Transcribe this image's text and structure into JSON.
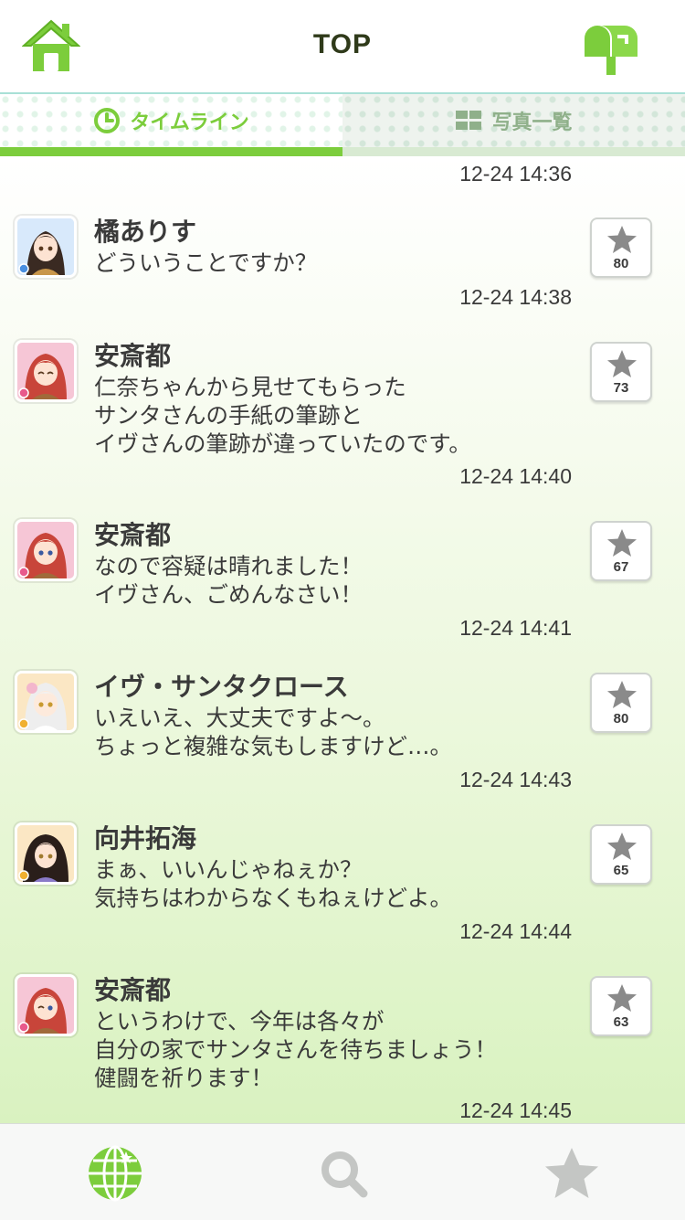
{
  "header": {
    "title": "TOP",
    "home_icon": "home-icon",
    "mail_icon": "mailbox-icon"
  },
  "tabs": [
    {
      "label": "タイムライン",
      "icon": "clock-icon",
      "active": true
    },
    {
      "label": "写真一覧",
      "icon": "grid-icon",
      "active": false
    }
  ],
  "feed": {
    "top_time": "12-24 14:36",
    "posts": [
      {
        "name": "橘ありす",
        "message": "どういうことですか？",
        "time": "12-24 14:38",
        "stars": "80",
        "badge_color": "#4a8fe0"
      },
      {
        "name": "安斎都",
        "message": "仁奈ちゃんから見せてもらった\nサンタさんの手紙の筆跡と\nイヴさんの筆跡が違っていたのです。",
        "time": "12-24 14:40",
        "stars": "73",
        "badge_color": "#e85a8c"
      },
      {
        "name": "安斎都",
        "message": "なので容疑は晴れました！\nイヴさん、ごめんなさい！",
        "time": "12-24 14:41",
        "stars": "67",
        "badge_color": "#e85a8c"
      },
      {
        "name": "イヴ・サンタクロース",
        "message": "いえいえ、大丈夫ですよ～。\nちょっと複雑な気もしますけど…。",
        "time": "12-24 14:43",
        "stars": "80",
        "badge_color": "#f0b030"
      },
      {
        "name": "向井拓海",
        "message": "まぁ、いいんじゃねぇか？\n気持ちはわからなくもねぇけどよ。",
        "time": "12-24 14:44",
        "stars": "65",
        "badge_color": "#f0b030"
      },
      {
        "name": "安斎都",
        "message": "というわけで、今年は各々が\n自分の家でサンタさんを待ちましょう！\n健闘を祈ります！",
        "time": "12-24 14:45",
        "stars": "63",
        "badge_color": "#e85a8c"
      }
    ]
  },
  "bottom_nav": {
    "items": [
      "globe-icon",
      "search-icon",
      "star-icon"
    ],
    "active": "globe-icon"
  },
  "colors": {
    "accent": "#7ccd3c",
    "text": "#3a3a3a",
    "inactive_icon": "#c4c6c4"
  }
}
